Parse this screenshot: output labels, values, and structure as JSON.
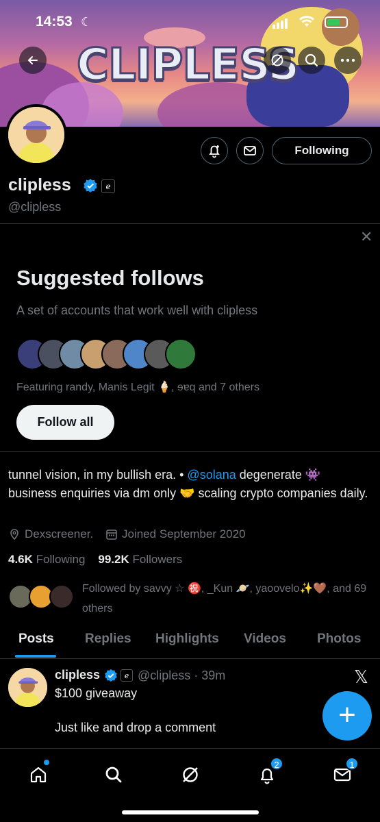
{
  "status_bar": {
    "time": "14:53"
  },
  "banner": {
    "logo_text": "CLIPLESS"
  },
  "profile": {
    "name": "clipless",
    "handle": "@clipless",
    "following_button": "Following",
    "bio_parts": [
      "tunnel vision, in my bullish era. • ",
      "@solana",
      " degenerate 👾 business enquiries via dm only 🤝 scaling crypto companies daily."
    ],
    "location": "Dexscreener.",
    "joined": "Joined September 2020",
    "following_count": "4.6K",
    "following_label": "Following",
    "followers_count": "99.2K",
    "followers_label": "Followers",
    "followed_by": "Followed by savvy ☆ ㊗️, _Kun 🪐, yaoovelo✨🤎, and 69 others"
  },
  "suggested": {
    "title": "Suggested follows",
    "subtitle": "A set of accounts that work well with clipless",
    "featuring": "Featuring randy, Manis Legit 🍦, ɘɐq and 7 others",
    "follow_all": "Follow all",
    "avatar_colors": [
      "#3a3f7a",
      "#4a5060",
      "#6f8ba5",
      "#c8a070",
      "#8a6a5a",
      "#4f86c9",
      "#5a5a5a",
      "#2f7a3a"
    ]
  },
  "tabs": [
    "Posts",
    "Replies",
    "Highlights",
    "Videos",
    "Photos"
  ],
  "post": {
    "name": "clipless",
    "meta": "@clipless · 39m",
    "line1": "$100 giveaway",
    "line2": "Just like and drop a comment"
  },
  "nav": {
    "notifications_badge": "2",
    "messages_badge": "1"
  },
  "colors": {
    "accent": "#1d9bf0",
    "bg": "#000000"
  }
}
